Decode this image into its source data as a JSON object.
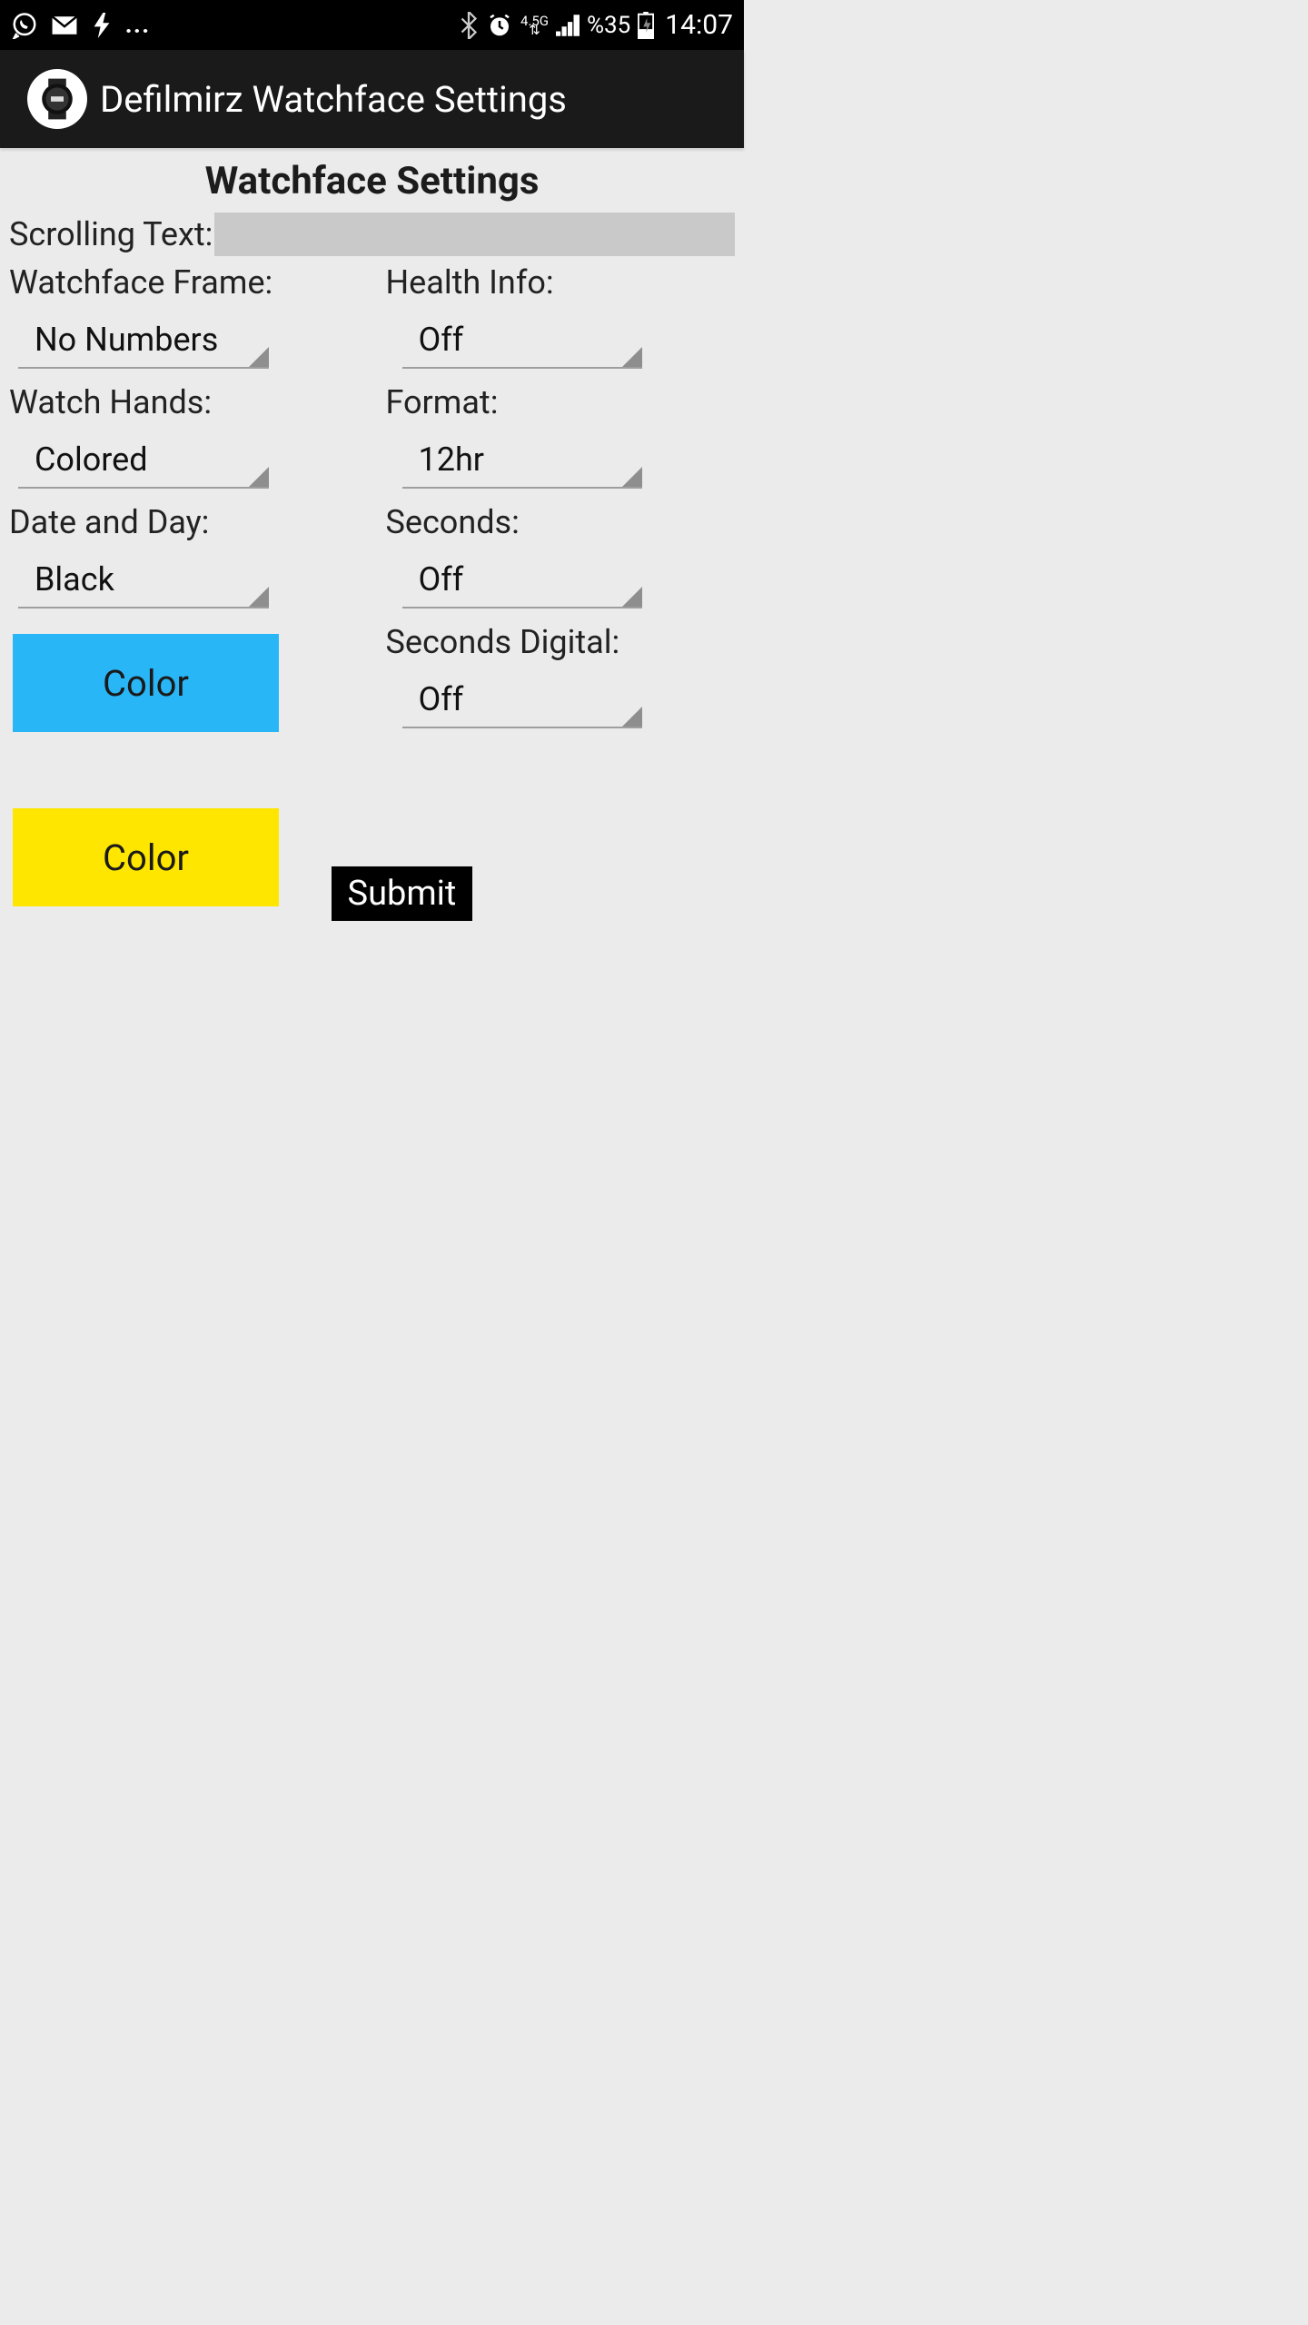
{
  "status": {
    "battery": "%35",
    "time": "14:07",
    "network": "4.5G"
  },
  "app": {
    "title": "Defilmirz Watchface Settings"
  },
  "page": {
    "title": "Watchface Settings",
    "scrolling_label": "Scrolling Text:",
    "scrolling_value": ""
  },
  "left": {
    "frame_label": "Watchface Frame:",
    "frame_value": "No Numbers",
    "hands_label": "Watch Hands:",
    "hands_value": "Colored",
    "date_label": "Date and Day:",
    "date_value": "Black",
    "color1": "Color",
    "color2": "Color"
  },
  "right": {
    "health_label": "Health Info:",
    "health_value": "Off",
    "format_label": "Format:",
    "format_value": "12hr",
    "seconds_label": "Seconds:",
    "seconds_value": "Off",
    "secdig_label": "Seconds Digital:",
    "secdig_value": "Off",
    "submit": "Submit"
  }
}
